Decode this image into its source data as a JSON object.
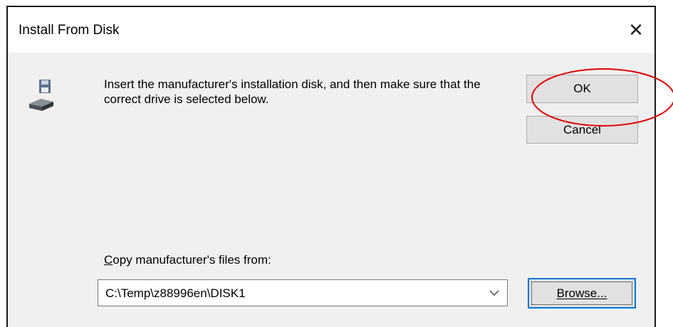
{
  "window": {
    "title": "Install From Disk",
    "close_glyph": "✕"
  },
  "icons": {
    "disk": "floppy-disk-drive-icon",
    "close": "close-icon",
    "dropdown": "chevron-down-icon"
  },
  "message": "Insert the manufacturer's installation disk, and then make sure that the correct drive is selected below.",
  "buttons": {
    "ok": "OK",
    "cancel": "Cancel",
    "browse": "Browse..."
  },
  "copy_from": {
    "label_accel": "C",
    "label_rest": "opy manufacturer's files from:",
    "value": "C:\\Temp\\z88996en\\DISK1"
  },
  "annotation": {
    "color": "#e00000",
    "target": "OK button"
  }
}
